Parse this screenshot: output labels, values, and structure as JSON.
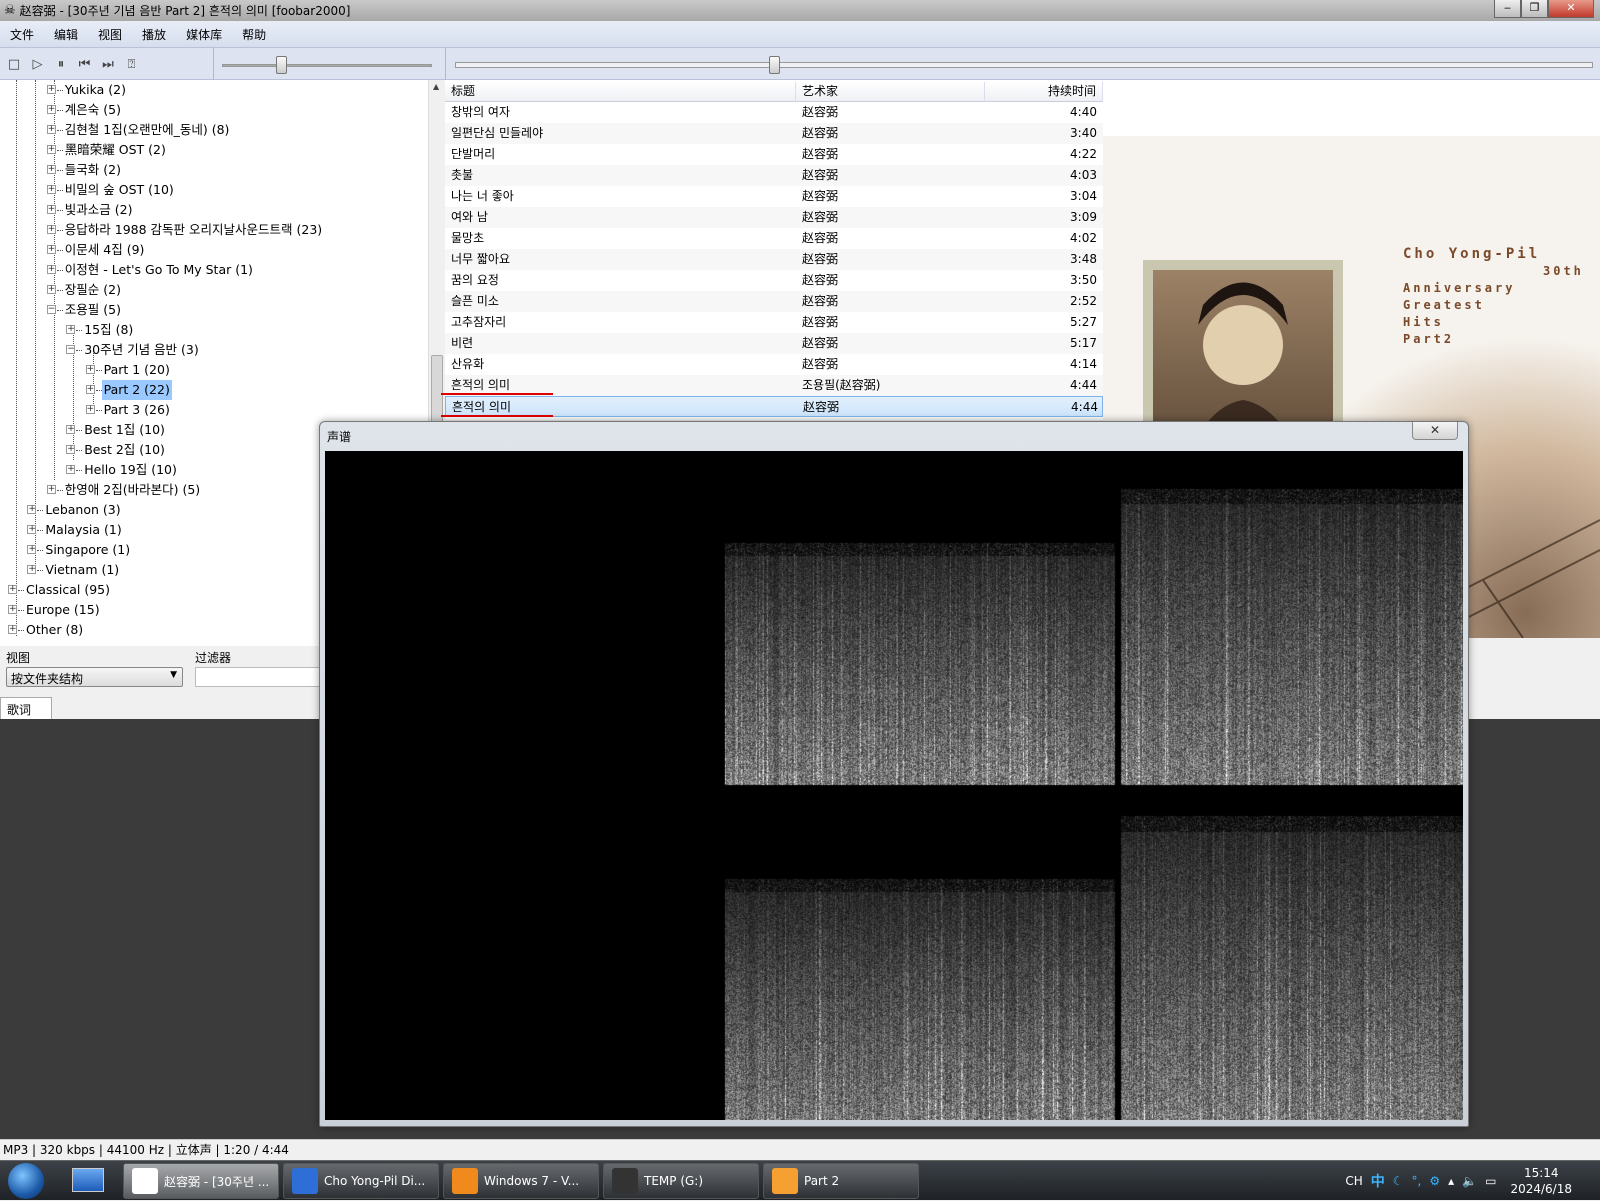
{
  "window": {
    "title": "赵容弼 - [30주년 기념 음반 Part 2] 흔적의 의미  [foobar2000]",
    "minimize": "‒",
    "maximize": "❐",
    "close": "✕"
  },
  "menu": [
    "文件",
    "编辑",
    "视图",
    "播放",
    "媒体库",
    "帮助"
  ],
  "toolbar": {
    "buttons": [
      {
        "name": "stop-icon",
        "glyph": "□"
      },
      {
        "name": "play-icon",
        "glyph": "▷"
      },
      {
        "name": "pause-icon",
        "glyph": "⏸"
      },
      {
        "name": "previous-icon",
        "glyph": "⏮"
      },
      {
        "name": "next-icon",
        "glyph": "⏭"
      },
      {
        "name": "random-icon",
        "glyph": "⍰"
      }
    ],
    "volume": 0.28,
    "seek": 0.28
  },
  "tree": [
    {
      "label": "Yukika (2)",
      "level": 2,
      "exp": "+"
    },
    {
      "label": "계은숙 (5)",
      "level": 2,
      "exp": "+"
    },
    {
      "label": "김현철 1집(오랜만에_동네) (8)",
      "level": 2,
      "exp": "+"
    },
    {
      "label": "黑暗荣耀 OST (2)",
      "level": 2,
      "exp": "+"
    },
    {
      "label": "들국화 (2)",
      "level": 2,
      "exp": "+"
    },
    {
      "label": "비밀의 숲 OST (10)",
      "level": 2,
      "exp": "+"
    },
    {
      "label": "빛과소금 (2)",
      "level": 2,
      "exp": "+"
    },
    {
      "label": "응답하라 1988 감독판 오리지날사운드트랙 (23)",
      "level": 2,
      "exp": "+"
    },
    {
      "label": "이문세 4집 (9)",
      "level": 2,
      "exp": "+"
    },
    {
      "label": "이정현 - Let's Go To My Star (1)",
      "level": 2,
      "exp": "+"
    },
    {
      "label": "장필순 (2)",
      "level": 2,
      "exp": "+"
    },
    {
      "label": "조용필 (5)",
      "level": 2,
      "exp": "−"
    },
    {
      "label": "15집 (8)",
      "level": 3,
      "exp": "+"
    },
    {
      "label": "30주년 기념 음반 (3)",
      "level": 3,
      "exp": "−"
    },
    {
      "label": "Part 1 (20)",
      "level": 4,
      "exp": "+"
    },
    {
      "label": "Part 2 (22)",
      "level": 4,
      "exp": "+",
      "selected": true
    },
    {
      "label": "Part 3 (26)",
      "level": 4,
      "exp": "+"
    },
    {
      "label": "Best 1집 (10)",
      "level": 3,
      "exp": "+"
    },
    {
      "label": "Best 2집 (10)",
      "level": 3,
      "exp": "+"
    },
    {
      "label": "Hello 19집 (10)",
      "level": 3,
      "exp": "+"
    },
    {
      "label": "한영애 2집(바라본다) (5)",
      "level": 2,
      "exp": "+"
    },
    {
      "label": "Lebanon (3)",
      "level": 1,
      "exp": "+"
    },
    {
      "label": "Malaysia (1)",
      "level": 1,
      "exp": "+"
    },
    {
      "label": "Singapore (1)",
      "level": 1,
      "exp": "+"
    },
    {
      "label": "Vietnam (1)",
      "level": 1,
      "exp": "+"
    },
    {
      "label": "Classical (95)",
      "level": 0,
      "exp": "+"
    },
    {
      "label": "Europe (15)",
      "level": 0,
      "exp": "+"
    },
    {
      "label": "Other (8)",
      "level": 0,
      "exp": "+"
    }
  ],
  "view": {
    "label": "视图",
    "selected": "按文件夹结构",
    "filter_label": "过滤器",
    "filter_value": ""
  },
  "lyrics_tab": "歌词",
  "playlist": {
    "columns": [
      "标题",
      "艺术家",
      "持续时间"
    ],
    "rows": [
      [
        "창밖의 여자",
        "赵容弼",
        "4:40"
      ],
      [
        "일편단심 민들레야",
        "赵容弼",
        "3:40"
      ],
      [
        "단발머리",
        "赵容弼",
        "4:22"
      ],
      [
        "촛불",
        "赵容弼",
        "4:03"
      ],
      [
        "나는 너 좋아",
        "赵容弼",
        "3:04"
      ],
      [
        "여와 남",
        "赵容弼",
        "3:09"
      ],
      [
        "물망초",
        "赵容弼",
        "4:02"
      ],
      [
        "너무 짧아요",
        "赵容弼",
        "3:48"
      ],
      [
        "꿈의 요정",
        "赵容弼",
        "3:50"
      ],
      [
        "슬픈 미소",
        "赵容弼",
        "2:52"
      ],
      [
        "고추잠자리",
        "赵容弼",
        "5:27"
      ],
      [
        "비련",
        "赵容弼",
        "5:17"
      ],
      [
        "산유화",
        "赵容弼",
        "4:14"
      ],
      [
        "흔적의 의미",
        "조용필(赵容弼)",
        "4:44"
      ],
      [
        "흔적의 의미",
        "赵容弼",
        "4:44"
      ]
    ],
    "playing_index": 14
  },
  "album_art": {
    "lines": [
      "Cho Yong-Pil",
      "30th",
      "Anniversary",
      "Greatest",
      "Hits",
      "Part2"
    ]
  },
  "spectrogram": {
    "title": "声谱",
    "close": "✕"
  },
  "status": "MP3 | 320 kbps | 44100 Hz | 立体声 | 1:20 / 4:44",
  "taskbar": {
    "tasks": [
      {
        "label": "赵容弼 - [30주년 ...",
        "icon": "foobar-icon",
        "color": "#ffffff",
        "active": true
      },
      {
        "label": "Cho Yong-Pil Di...",
        "icon": "app-icon",
        "color": "#2d6fd6"
      },
      {
        "label": "Windows 7 - V...",
        "icon": "vmware-icon",
        "color": "#f08a1c"
      },
      {
        "label": "TEMP (G:)",
        "icon": "drive-icon",
        "color": "#333333"
      },
      {
        "label": "Part 2",
        "icon": "folder-icon",
        "color": "#f5a030"
      }
    ],
    "tray": {
      "lang": "CH",
      "ime": "中",
      "time": "15:14",
      "date": "2024/6/18"
    }
  }
}
